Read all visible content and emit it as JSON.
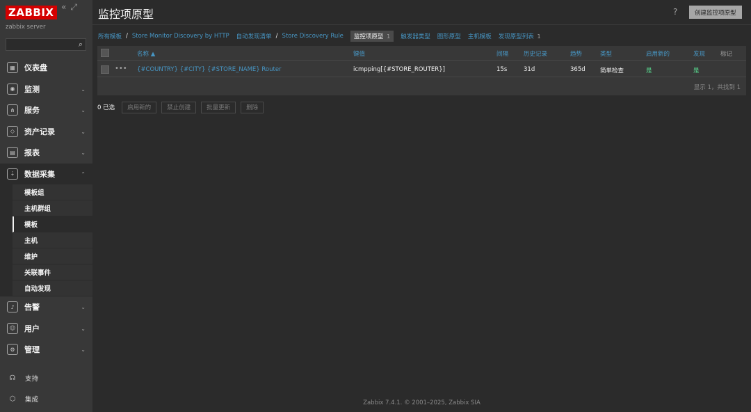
{
  "sidebar": {
    "logo": "ZABBIX",
    "collapse_icon": "double-chevron-left-icon",
    "kiosk_icon": "kiosk-mode-icon",
    "server_name": "zabbix server",
    "search_placeholder": "",
    "menu": [
      {
        "label": "仪表盘",
        "icon": "dashboard-icon",
        "chevron": ""
      },
      {
        "label": "监测",
        "icon": "monitoring-icon",
        "chevron": "⌄"
      },
      {
        "label": "服务",
        "icon": "services-icon",
        "chevron": "⌄"
      },
      {
        "label": "资产记录",
        "icon": "inventory-icon",
        "chevron": "⌄"
      },
      {
        "label": "报表",
        "icon": "reports-icon",
        "chevron": "⌄"
      },
      {
        "label": "数据采集",
        "icon": "data-collection-icon",
        "chevron": "⌃"
      }
    ],
    "submenu": [
      {
        "label": "模板组"
      },
      {
        "label": "主机群组"
      },
      {
        "label": "模板"
      },
      {
        "label": "主机"
      },
      {
        "label": "维护"
      },
      {
        "label": "关联事件"
      },
      {
        "label": "自动发现"
      }
    ],
    "menu_after": [
      {
        "label": "告警",
        "icon": "alerts-icon",
        "chevron": "⌄"
      },
      {
        "label": "用户",
        "icon": "users-icon",
        "chevron": "⌄"
      },
      {
        "label": "管理",
        "icon": "administration-icon",
        "chevron": "⌄"
      }
    ],
    "bottom": [
      {
        "label": "支持",
        "icon": "support-icon"
      },
      {
        "label": "集成",
        "icon": "integrations-icon"
      }
    ]
  },
  "header": {
    "title": "监控项原型",
    "help": "?",
    "create_button": "创建监控项原型"
  },
  "breadcrumb": {
    "all_templates": "所有模板",
    "template": "Store Monitor Discovery by HTTP",
    "discovery_list": "自动发现清单",
    "discovery_rule": "Store Discovery Rule",
    "tabs": [
      {
        "label": "监控项原型",
        "count": "1",
        "active": true
      },
      {
        "label": "触发器类型",
        "count": "",
        "active": false
      },
      {
        "label": "图形原型",
        "count": "",
        "active": false
      },
      {
        "label": "主机模板",
        "count": "",
        "active": false
      },
      {
        "label": "发现原型列表",
        "count": "1",
        "active": false
      }
    ]
  },
  "table": {
    "columns": {
      "name": "名称 ▲",
      "key": "键值",
      "interval": "间隔",
      "history": "历史记录",
      "trends": "趋势",
      "type": "类型",
      "create_enabled": "启用新的",
      "discover": "发现",
      "tags": "标记"
    },
    "rows": [
      {
        "name": "{#COUNTRY} {#CITY} {#STORE_NAME} Router",
        "key": "icmpping[{#STORE_ROUTER}]",
        "interval": "15s",
        "history": "31d",
        "trends": "365d",
        "type": "简单检查",
        "create_enabled": "是",
        "discover": "是",
        "tags": ""
      }
    ],
    "footer": "显示 1，共找到 1"
  },
  "actions": {
    "selected": "0 已选",
    "buttons": [
      "启用新的",
      "禁止创建",
      "批量更新",
      "删除"
    ]
  },
  "footer": {
    "text": "Zabbix 7.4.1. © 2001–2025, Zabbix SIA"
  },
  "colors": {
    "logo_red": "#d40000",
    "link_blue": "#4796c4",
    "status_green": "#59db8f",
    "sidebar_bg": "#383838",
    "page_bg": "#2b2b2b"
  }
}
